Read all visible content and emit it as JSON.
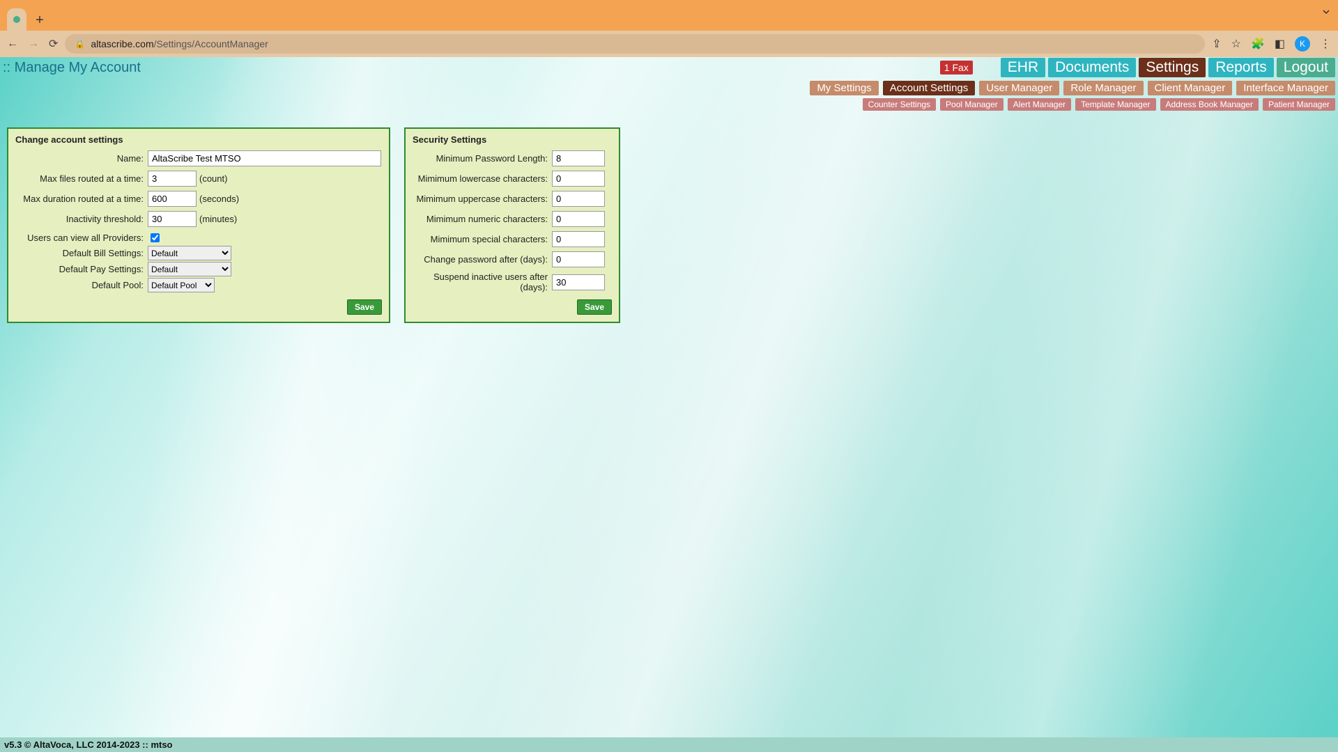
{
  "browser": {
    "url_host": "altascribe.com",
    "url_path": "/Settings/AccountManager",
    "avatar_letter": "K"
  },
  "header": {
    "page_title": ":: Manage My Account",
    "fax_badge": "1 Fax",
    "top_tabs": {
      "ehr": "EHR",
      "documents": "Documents",
      "settings": "Settings",
      "reports": "Reports",
      "logout": "Logout"
    },
    "sub_tabs": {
      "my_settings": "My Settings",
      "account_settings": "Account Settings",
      "user_manager": "User Manager",
      "role_manager": "Role Manager",
      "client_manager": "Client Manager",
      "interface_manager": "Interface Manager"
    },
    "tert_tabs": {
      "counter": "Counter Settings",
      "pool": "Pool Manager",
      "alert": "Alert Manager",
      "template": "Template Manager",
      "addressbook": "Address Book Manager",
      "patient": "Patient Manager"
    }
  },
  "panels": {
    "change": {
      "title": "Change account settings",
      "labels": {
        "name": "Name:",
        "max_files": "Max files routed at a time:",
        "max_duration": "Max duration routed at a time:",
        "inactivity": "Inactivity threshold:",
        "view_providers": "Users can view all Providers:",
        "bill": "Default Bill Settings:",
        "pay": "Default Pay Settings:",
        "pool": "Default Pool:"
      },
      "values": {
        "name": "AltaScribe Test MTSO",
        "max_files": "3",
        "max_duration": "600",
        "inactivity": "30",
        "bill": "Default",
        "pay": "Default",
        "pool": "Default Pool"
      },
      "suffixes": {
        "count": "(count)",
        "seconds": "(seconds)",
        "minutes": "(minutes)"
      },
      "save": "Save"
    },
    "security": {
      "title": "Security Settings",
      "labels": {
        "min_len": "Minimum Password Length:",
        "min_lower": "Mimimum lowercase characters:",
        "min_upper": "Mimimum uppercase characters:",
        "min_numeric": "Mimimum numeric characters:",
        "min_special": "Mimimum special characters:",
        "change_after": "Change password after (days):",
        "suspend_after": "Suspend inactive users after (days):"
      },
      "values": {
        "min_len": "8",
        "min_lower": "0",
        "min_upper": "0",
        "min_numeric": "0",
        "min_special": "0",
        "change_after": "0",
        "suspend_after": "30"
      },
      "save": "Save"
    }
  },
  "footer": "v5.3 © AltaVoca, LLC 2014-2023 :: mtso"
}
